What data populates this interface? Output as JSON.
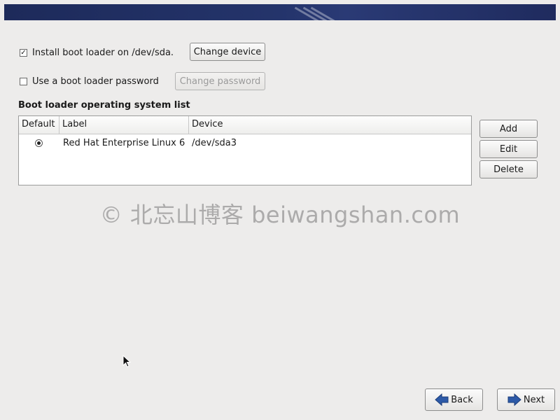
{
  "bootloader": {
    "install_checked": true,
    "install_label": "Install boot loader on /dev/sda.",
    "change_device_label": "Change device",
    "password_checked": false,
    "password_label": "Use a boot loader password",
    "change_password_label": "Change password"
  },
  "os_list": {
    "title": "Boot loader operating system list",
    "columns": [
      "Default",
      "Label",
      "Device"
    ],
    "rows": [
      {
        "default": true,
        "label": "Red Hat Enterprise Linux 6",
        "device": "/dev/sda3"
      }
    ],
    "add_label": "Add",
    "edit_label": "Edit",
    "delete_label": "Delete"
  },
  "watermark": "© 北忘山博客 beiwangshan.com",
  "nav": {
    "back_label": "Back",
    "next_label": "Next"
  },
  "colors": {
    "banner": "#24346b",
    "arrow": "#2d5aa8"
  }
}
